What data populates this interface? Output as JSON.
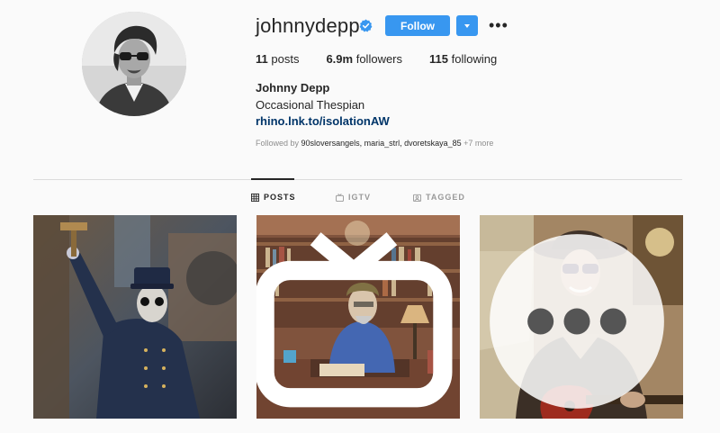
{
  "profile": {
    "username": "johnnydepp",
    "follow_label": "Follow",
    "more_label": "•••",
    "stats": [
      {
        "count": "11",
        "label": "posts"
      },
      {
        "count": "6.9m",
        "label": "followers"
      },
      {
        "count": "115",
        "label": "following"
      }
    ],
    "full_name": "Johnny Depp",
    "bio": "Occasional Thespian",
    "link": "rhino.lnk.to/isolationAW",
    "followed_by_prefix": "Followed by",
    "followed_by_names": "90sloversangels, maria_strl, dvoretskaya_85",
    "followed_by_more": "+7 more"
  },
  "tabs": [
    {
      "label": "POSTS",
      "icon": "grid-icon",
      "active": true
    },
    {
      "label": "IGTV",
      "icon": "igtv-icon",
      "active": false
    },
    {
      "label": "TAGGED",
      "icon": "tagged-icon",
      "active": false
    }
  ],
  "colors": {
    "accent": "#3897f0",
    "link": "#003569",
    "background": "#fafafa",
    "muted": "#8e8e8e"
  },
  "posts": [
    {
      "kind": "image",
      "badge": null
    },
    {
      "kind": "igtv",
      "badge": "igtv-badge-icon"
    },
    {
      "kind": "video",
      "badge": "video-badge-icon"
    }
  ]
}
